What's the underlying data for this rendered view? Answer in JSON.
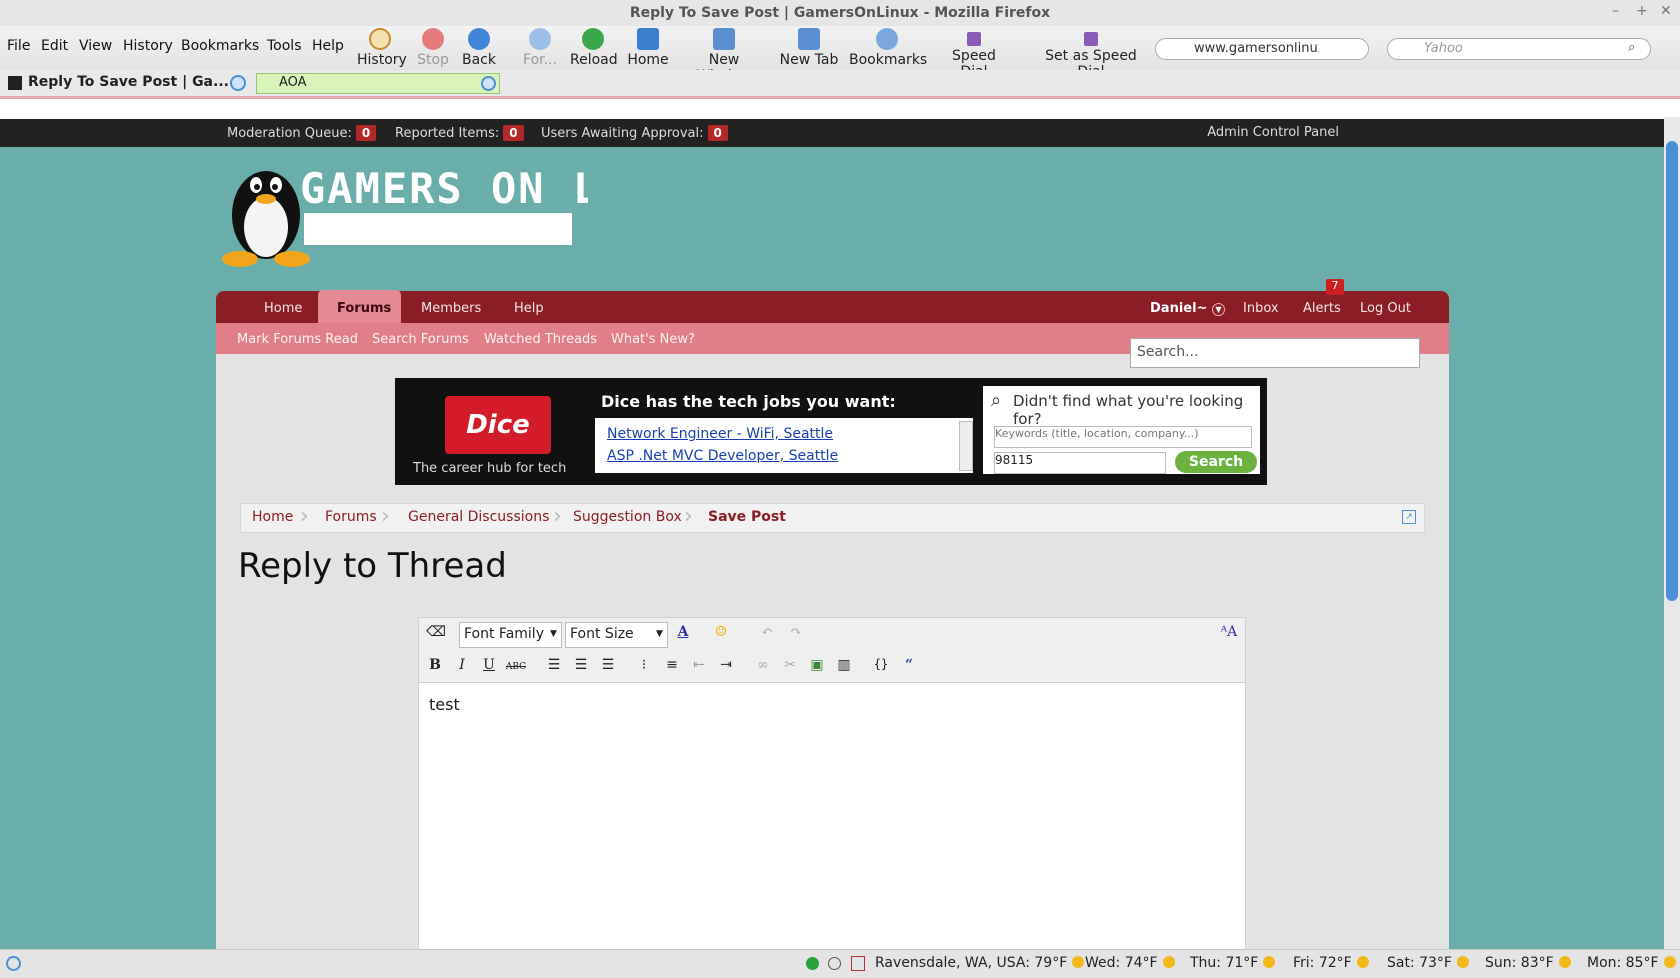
{
  "window": {
    "title": "Reply To Save Post | GamersOnLinux - Mozilla Firefox"
  },
  "menu": [
    "File",
    "Edit",
    "View",
    "History",
    "Bookmarks",
    "Tools",
    "Help"
  ],
  "toolbar": {
    "history": "History",
    "stop": "Stop",
    "back": "Back",
    "forward": "For...",
    "reload": "Reload",
    "home": "Home",
    "new_window": "New Window",
    "new_tab": "New Tab",
    "bookmarks": "Bookmarks",
    "speed_dial": "Speed Dial",
    "set_speed_dial": "Set as Speed Dial",
    "url": "www.gamersonlinux",
    "search_placeholder": "Yahoo"
  },
  "tabs": [
    {
      "label": "Reply To Save Post | Ga..."
    },
    {
      "label": "AOA"
    }
  ],
  "modbar": {
    "moderation_queue": "Moderation Queue:",
    "moderation_count": "0",
    "reported_items": "Reported Items:",
    "reported_count": "0",
    "users_awaiting": "Users Awaiting Approval:",
    "users_count": "0",
    "admin_panel": "Admin Control Panel"
  },
  "logo": {
    "text": "GAMERS ON LINUX"
  },
  "nav": {
    "home": "Home",
    "forums": "Forums",
    "members": "Members",
    "help": "Help",
    "user": "Daniel~",
    "inbox": "Inbox",
    "alerts": "Alerts",
    "alerts_count": "7",
    "logout": "Log Out"
  },
  "subnav": {
    "mark_read": "Mark Forums Read",
    "search_forums": "Search Forums",
    "watched": "Watched Threads",
    "whats_new": "What's New?",
    "search_placeholder": "Search..."
  },
  "ad": {
    "brand": "Dice",
    "tagline": "The career hub for tech",
    "headline": "Dice has the tech jobs you want:",
    "jobs": [
      "Network Engineer - WiFi, Seattle",
      "ASP .Net MVC Developer, Seattle"
    ],
    "question": "Didn't find what you're looking for?",
    "keywords_placeholder": "Keywords (title, location, company...)",
    "zip": "98115",
    "search_button": "Search"
  },
  "breadcrumb": [
    "Home",
    "Forums",
    "General Discussions",
    "Suggestion Box",
    "Save Post"
  ],
  "page_title": "Reply to Thread",
  "editor": {
    "font_family": "Font Family",
    "font_size": "Font Size",
    "content": "test"
  },
  "status": {
    "location": "Ravensdale, WA, USA: 79°F",
    "forecast": [
      "Wed: 74°F",
      "Thu: 71°F",
      "Fri: 72°F",
      "Sat: 73°F",
      "Sun: 83°F",
      "Mon: 85°F"
    ]
  }
}
